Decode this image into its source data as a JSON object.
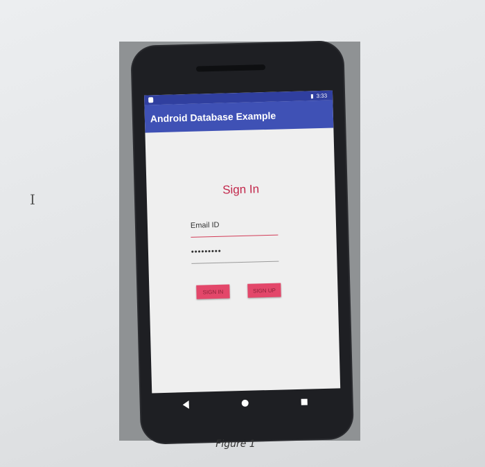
{
  "status_bar": {
    "time": "3:33"
  },
  "app_bar": {
    "title": "Android Database Example"
  },
  "form": {
    "title": "Sign In",
    "email_placeholder": "Email ID",
    "password_value": "•••••••••"
  },
  "buttons": {
    "sign_in": "SIGN IN",
    "sign_up": "SIGN UP"
  },
  "caption": "Figure 1",
  "colors": {
    "status_bar": "#303f9f",
    "app_bar": "#3f51b5",
    "title_text": "#c2264a",
    "button_bg": "#e3476a"
  },
  "icons": {
    "navbar": [
      "back-icon",
      "home-icon",
      "recents-icon"
    ]
  }
}
